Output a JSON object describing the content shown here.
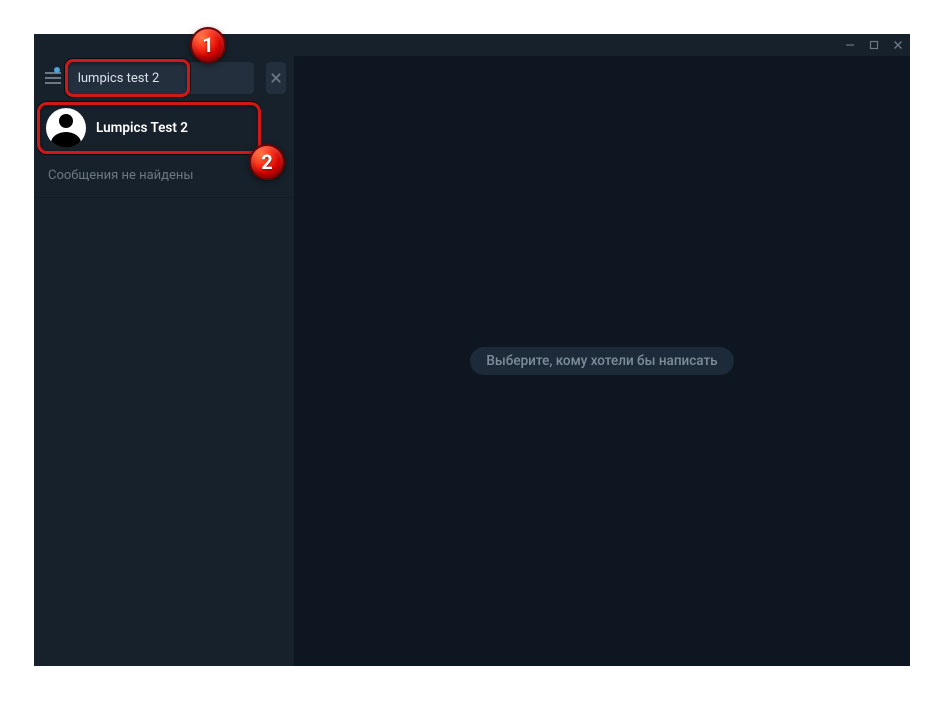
{
  "search": {
    "value": "lumpics test 2"
  },
  "result": {
    "name": "Lumpics Test 2"
  },
  "sidebar": {
    "no_messages": "Сообщения не найдены"
  },
  "main": {
    "empty_prompt": "Выберите, кому хотели бы написать"
  },
  "annotations": {
    "badge1": "1",
    "badge2": "2"
  }
}
